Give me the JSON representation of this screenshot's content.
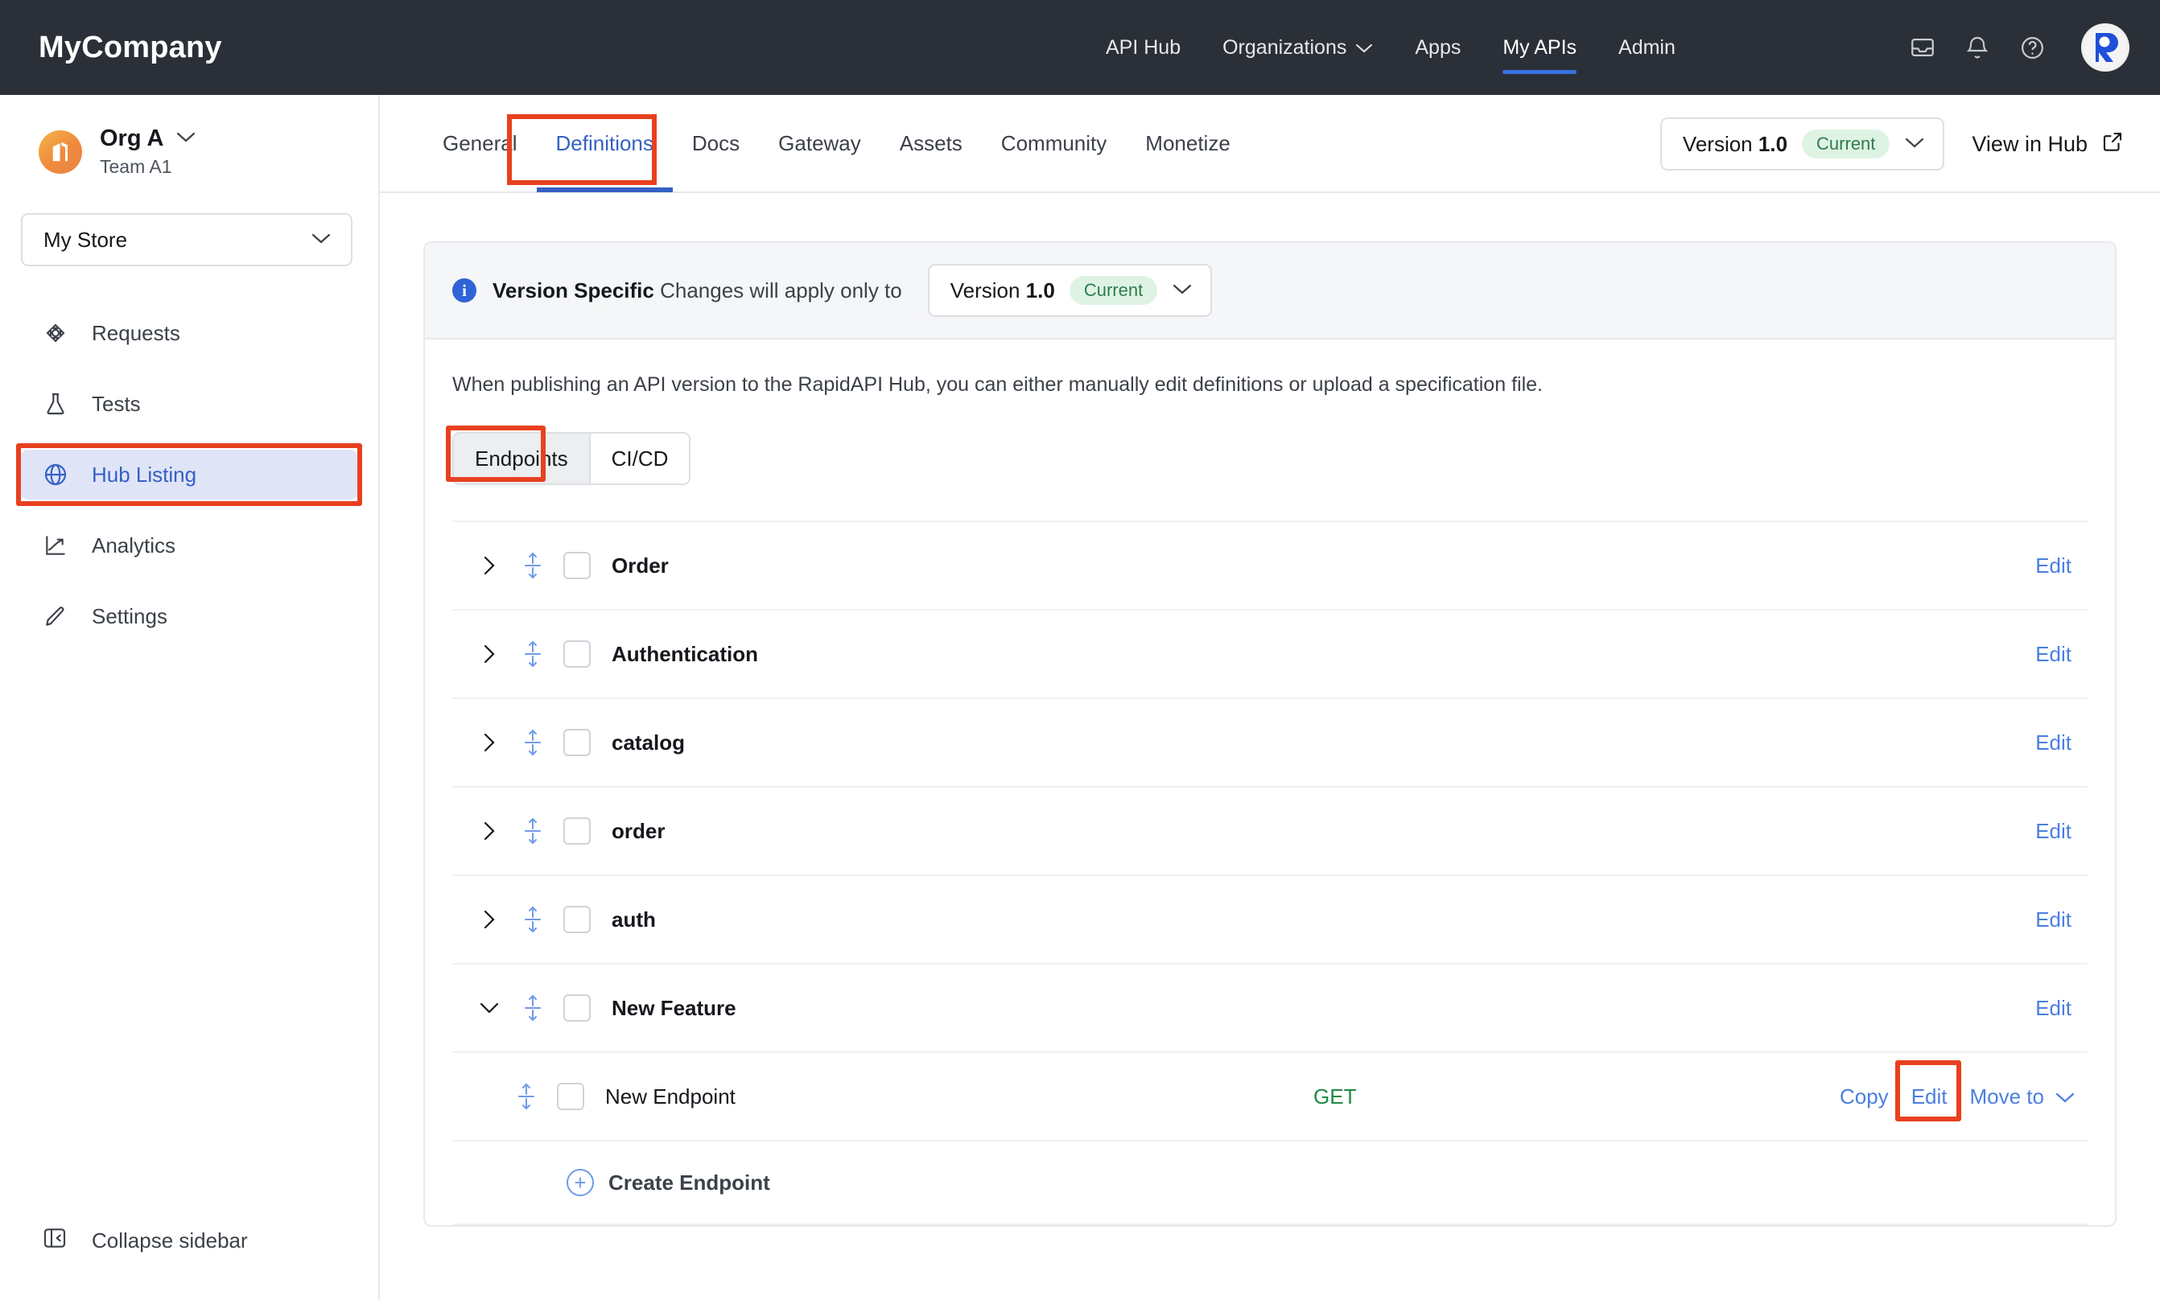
{
  "header": {
    "brand": "MyCompany",
    "nav": [
      {
        "label": "API Hub",
        "has_caret": false,
        "active": false
      },
      {
        "label": "Organizations",
        "has_caret": true,
        "active": false
      },
      {
        "label": "Apps",
        "has_caret": false,
        "active": false
      },
      {
        "label": "My APIs",
        "has_caret": false,
        "active": true
      },
      {
        "label": "Admin",
        "has_caret": false,
        "active": false
      }
    ],
    "icons": [
      "inbox-icon",
      "bell-icon",
      "help-icon"
    ],
    "avatar": "user-avatar"
  },
  "sidebar": {
    "org_name": "Org A",
    "org_team": "Team A1",
    "store_label": "My Store",
    "items": [
      {
        "label": "Requests",
        "icon": "requests-icon",
        "active": false
      },
      {
        "label": "Tests",
        "icon": "flask-icon",
        "active": false
      },
      {
        "label": "Hub Listing",
        "icon": "globe-icon",
        "active": true
      },
      {
        "label": "Analytics",
        "icon": "analytics-icon",
        "active": false
      },
      {
        "label": "Settings",
        "icon": "pencil-icon",
        "active": false
      }
    ],
    "collapse_label": "Collapse sidebar"
  },
  "tabs": [
    {
      "label": "General",
      "active": false
    },
    {
      "label": "Definitions",
      "active": true
    },
    {
      "label": "Docs",
      "active": false
    },
    {
      "label": "Gateway",
      "active": false
    },
    {
      "label": "Assets",
      "active": false
    },
    {
      "label": "Community",
      "active": false
    },
    {
      "label": "Monetize",
      "active": false
    }
  ],
  "version_selector": {
    "prefix": "Version",
    "number": "1.0",
    "badge": "Current"
  },
  "view_in_hub": "View in Hub",
  "panel": {
    "banner_title": "Version Specific",
    "banner_text": "Changes will apply only to",
    "banner_version_prefix": "Version",
    "banner_version_number": "1.0",
    "banner_badge": "Current",
    "description": "When publishing an API version to the RapidAPI Hub, you can either manually edit definitions or upload a specification file.",
    "segments": [
      {
        "label": "Endpoints",
        "active": true
      },
      {
        "label": "CI/CD",
        "active": false
      }
    ],
    "edit_label": "Edit",
    "copy_label": "Copy",
    "move_to_label": "Move to",
    "create_endpoint_label": "Create Endpoint",
    "groups": [
      {
        "name": "Order",
        "expanded": false
      },
      {
        "name": "Authentication",
        "expanded": false
      },
      {
        "name": "catalog",
        "expanded": false
      },
      {
        "name": "order",
        "expanded": false
      },
      {
        "name": "auth",
        "expanded": false
      },
      {
        "name": "New Feature",
        "expanded": true
      }
    ],
    "endpoints": [
      {
        "name": "New Endpoint",
        "method": "GET"
      }
    ]
  },
  "colors": {
    "annotation": "#e8401f",
    "accent_blue": "#3561c4",
    "link_blue": "#4a7fe0",
    "method_green": "#1f8a45",
    "topbar_bg": "#2b3038"
  }
}
